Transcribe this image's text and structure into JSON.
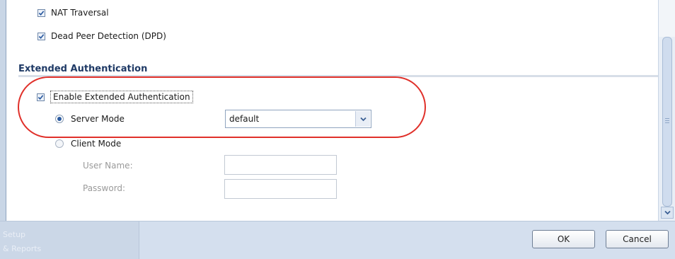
{
  "options": {
    "nat_traversal": {
      "label": "NAT Traversal",
      "checked": true
    },
    "dpd": {
      "label": "Dead Peer Detection (DPD)",
      "checked": true
    }
  },
  "extended_auth": {
    "section_title": "Extended Authentication",
    "enable": {
      "label": "Enable Extended Authentication",
      "checked": true
    },
    "server_mode": {
      "label": "Server Mode",
      "selected": true,
      "select_value": "default"
    },
    "client_mode": {
      "label": "Client Mode",
      "selected": false,
      "user_name_label": "User Name:",
      "password_label": "Password:",
      "user_name_value": "",
      "password_value": ""
    }
  },
  "footer": {
    "nav_ghost_1": "Setup",
    "nav_ghost_2": "& Reports",
    "ok_label": "OK",
    "cancel_label": "Cancel"
  },
  "colors": {
    "highlight": "#e0302a",
    "section_title": "#1f3a66",
    "footer_bg": "#d4dfee"
  }
}
